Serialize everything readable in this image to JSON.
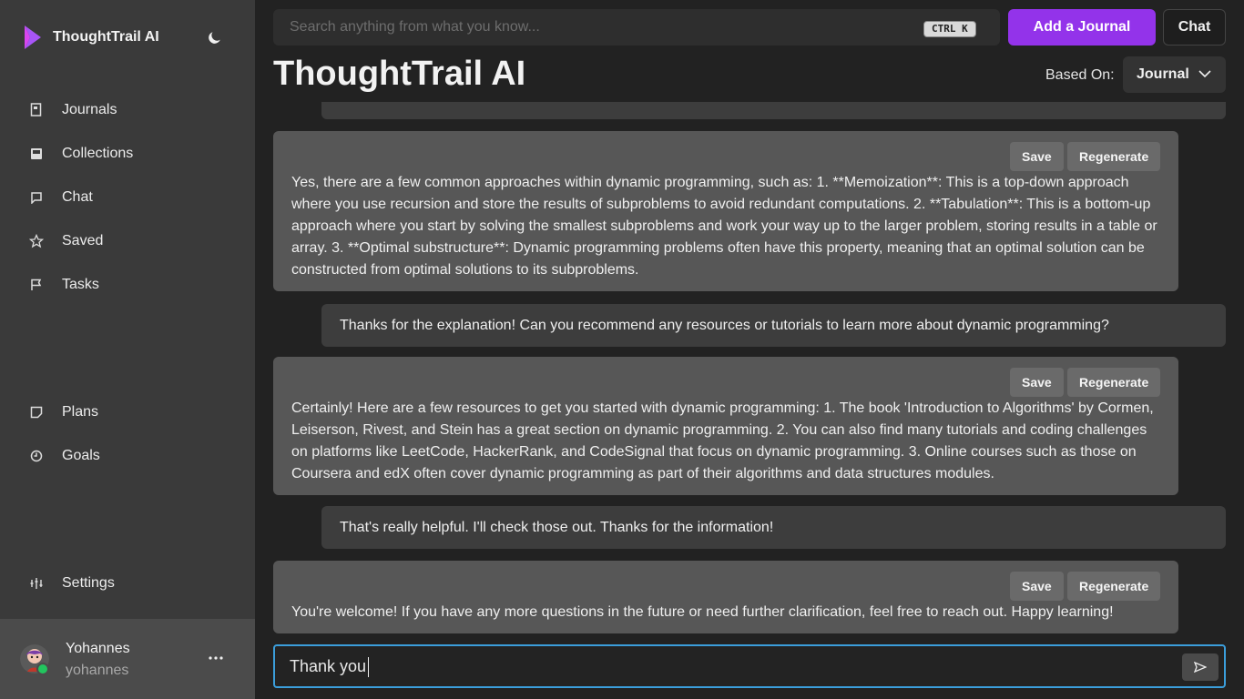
{
  "app": {
    "name": "ThoughtTrail AI"
  },
  "sidebar": {
    "items": [
      {
        "label": "Journals",
        "icon": "journal-icon"
      },
      {
        "label": "Collections",
        "icon": "inbox-icon"
      },
      {
        "label": "Chat",
        "icon": "chat-bubble-icon"
      },
      {
        "label": "Saved",
        "icon": "star-icon"
      },
      {
        "label": "Tasks",
        "icon": "flag-icon"
      },
      {
        "label": "Plans",
        "icon": "sticky-note-icon"
      },
      {
        "label": "Goals",
        "icon": "timer-icon"
      }
    ],
    "settings_label": "Settings"
  },
  "user": {
    "name": "Yohannes",
    "handle": "yohannes"
  },
  "header": {
    "search_placeholder": "Search anything from what you know...",
    "shortcut": "CTRL K",
    "add_journal_label": "Add a Journal",
    "chat_label": "Chat",
    "title": "ThoughtTrail AI",
    "based_on_label": "Based On:",
    "based_on_value": "Journal"
  },
  "conversation": {
    "save_label": "Save",
    "regenerate_label": "Regenerate",
    "messages": [
      {
        "role": "ai",
        "text": "Yes, there are a few common approaches within dynamic programming, such as: 1. **Memoization**: This is a top-down approach where you use recursion and store the results of subproblems to avoid redundant computations. 2. **Tabulation**: This is a bottom-up approach where you start by solving the smallest subproblems and work your way up to the larger problem, storing results in a table or array. 3. **Optimal substructure**: Dynamic programming problems often have this property, meaning that an optimal solution can be constructed from optimal solutions to its subproblems."
      },
      {
        "role": "user",
        "text": "Thanks for the explanation! Can you recommend any resources or tutorials to learn more about dynamic programming?"
      },
      {
        "role": "ai",
        "text": "Certainly! Here are a few resources to get you started with dynamic programming: 1. The book 'Introduction to Algorithms' by Cormen, Leiserson, Rivest, and Stein has a great section on dynamic programming. 2. You can also find many tutorials and coding challenges on platforms like LeetCode, HackerRank, and CodeSignal that focus on dynamic programming. 3. Online courses such as those on Coursera and edX often cover dynamic programming as part of their algorithms and data structures modules."
      },
      {
        "role": "user",
        "text": "That's really helpful. I'll check those out. Thanks for the information!"
      },
      {
        "role": "ai",
        "text": "You're welcome! If you have any more questions in the future or need further clarification, feel free to reach out. Happy learning!"
      }
    ]
  },
  "composer": {
    "value": "Thank you"
  },
  "colors": {
    "accent": "#9333ea",
    "focus": "#3b9edb",
    "online": "#22c55e"
  }
}
